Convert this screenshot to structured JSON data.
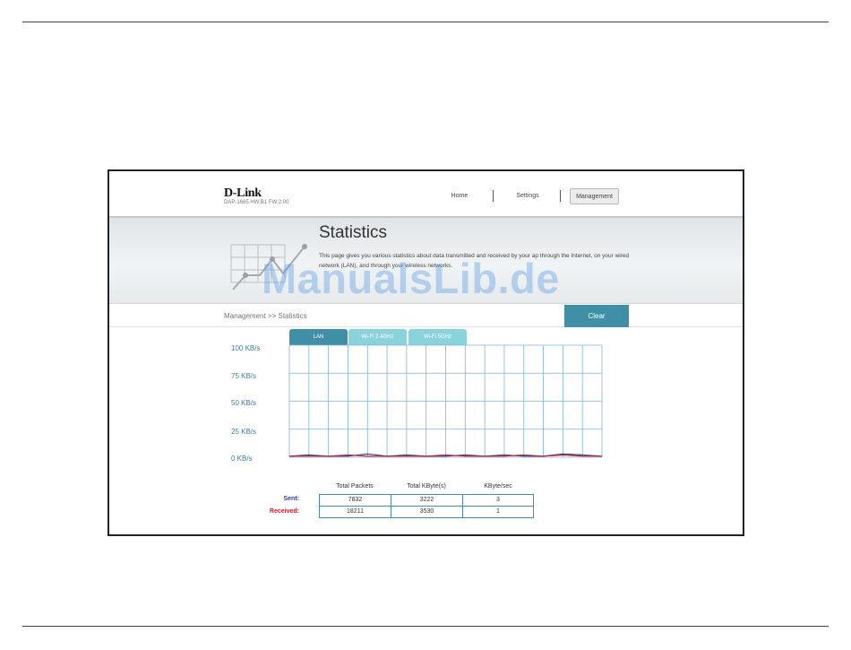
{
  "brand": {
    "logo_text": "D-Link",
    "model_text": "DAP-1665 HW:B1 FW:2.00"
  },
  "nav": {
    "items": [
      {
        "label": "Home",
        "active": false
      },
      {
        "label": "Settings",
        "active": false
      },
      {
        "label": "Management",
        "active": true
      }
    ]
  },
  "banner": {
    "title": "Statistics",
    "description": "This page gives you various statistics about data transmitted and received by your ap through the Internet, on your wired network (LAN), and through your wireless networks."
  },
  "breadcrumb": "Management >> Statistics",
  "actions": {
    "clear_label": "Clear"
  },
  "tabs": [
    {
      "label": "LAN",
      "active": true
    },
    {
      "label": "Wi-Fi 2.4GHz",
      "active": false
    },
    {
      "label": "Wi-Fi 5GHz",
      "active": false
    }
  ],
  "chart_data": {
    "type": "line",
    "y_ticks": [
      "100 KB/s",
      "75 KB/s",
      "50 KB/s",
      "25 KB/s",
      "0 KB/s"
    ],
    "ylim": [
      0,
      100
    ],
    "grid": true,
    "x": [
      0,
      1,
      2,
      3,
      4,
      5,
      6,
      7,
      8,
      9,
      10,
      11,
      12,
      13,
      14,
      15,
      16
    ],
    "series": [
      {
        "color": "#2f3f8f",
        "values": [
          1,
          2,
          1,
          1,
          3,
          1,
          2,
          1,
          1,
          2,
          1,
          2,
          1,
          1,
          3,
          2,
          1
        ]
      },
      {
        "color": "#cc1f2f",
        "values": [
          1,
          1,
          1,
          2,
          1,
          1,
          1,
          1,
          2,
          1,
          1,
          1,
          2,
          1,
          2,
          1,
          1
        ]
      }
    ]
  },
  "stats_table": {
    "headers": [
      "Total Packets",
      "Total KByte(s)",
      "KByte/sec"
    ],
    "rows": [
      {
        "label": "Sent:",
        "values": [
          "7832",
          "3222",
          "3"
        ],
        "color": "#2f3f8f"
      },
      {
        "label": "Received:",
        "values": [
          "18211",
          "3530",
          "1"
        ],
        "color": "#cc1f2f"
      }
    ]
  },
  "watermark": "ManualsLib.de",
  "colors": {
    "accent": "#3f8fa6",
    "tab_inactive": "#8ad3dc",
    "grid": "#7fb4d4"
  }
}
